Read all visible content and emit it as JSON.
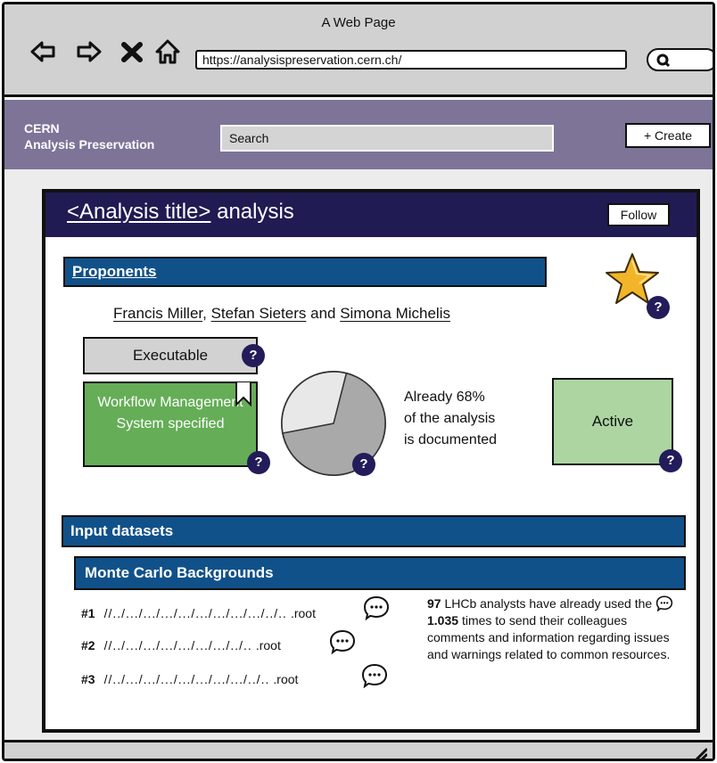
{
  "browser": {
    "window_title": "A Web Page",
    "url": "https://analysispreservation.cern.ch/"
  },
  "header": {
    "brand_line1": "CERN",
    "brand_line2": "Analysis Preservation",
    "search_value": "Search",
    "create_label": "+ Create"
  },
  "analysis": {
    "title_link": "<Analysis title>",
    "title_suffix": "analysis",
    "follow_label": "Follow",
    "proponents_label": "Proponents",
    "proponents": [
      "Francis Miller",
      "Stefan Sieters",
      "Simona Michelis"
    ],
    "proponents_sep": ",",
    "proponents_and": "and",
    "executable_label": "Executable",
    "wms_label": "Workflow Management System specified",
    "documented_percent": 68,
    "documented_text": [
      "Already 68%",
      "of the analysis",
      "is documented"
    ],
    "status_label": "Active",
    "help_glyph": "?"
  },
  "inputs": {
    "section_label": "Input datasets",
    "group_label": "Monte Carlo Backgrounds",
    "datasets": [
      {
        "id": "#1",
        "path": "//../.../.../.../.../.../.../.../.../../..",
        "ext": ".root"
      },
      {
        "id": "#2",
        "path": "//../.../.../.../.../.../.../../..",
        "ext": ".root"
      },
      {
        "id": "#3",
        "path": "//../.../.../.../.../.../.../.../../..",
        "ext": ".root"
      }
    ]
  },
  "comments": {
    "analyst_count": "97",
    "text_1": "LHCb analysts have already used the",
    "usage_count": "1.035",
    "text_2": "times to send their colleagues comments and information regarding issues and warnings related to common resources."
  },
  "colors": {
    "header_purple": "#7d7498",
    "card_navy": "#201b52",
    "section_blue": "#115189",
    "wms_green": "#65ad57",
    "active_green": "#add5a2",
    "star_gold": "#f2b52a"
  },
  "icons": {
    "back": "arrow-left-icon",
    "forward": "arrow-right-icon",
    "stop": "close-icon",
    "home": "home-icon",
    "search": "search-icon",
    "favorite": "star-icon",
    "bookmark": "bookmark-icon",
    "comment": "comment-bubble-icon",
    "help": "question-icon",
    "resize": "resize-grip-icon"
  }
}
